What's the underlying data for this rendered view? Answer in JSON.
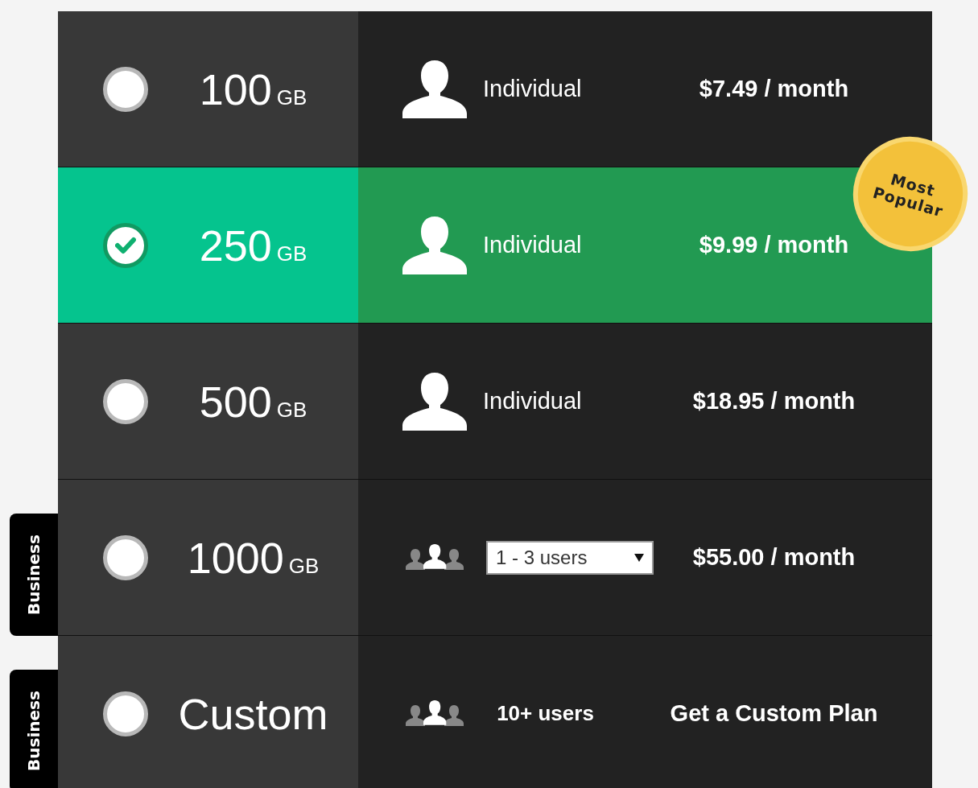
{
  "plans": [
    {
      "size": "100",
      "unit": "GB",
      "selected": false,
      "audience": {
        "kind": "individual",
        "label": "Individual"
      },
      "price": "$7.49 / month"
    },
    {
      "size": "250",
      "unit": "GB",
      "selected": true,
      "badge": "Most Popular",
      "audience": {
        "kind": "individual",
        "label": "Individual"
      },
      "price": "$9.99 / month"
    },
    {
      "size": "500",
      "unit": "GB",
      "selected": false,
      "audience": {
        "kind": "individual",
        "label": "Individual"
      },
      "price": "$18.95 / month"
    },
    {
      "size": "1000",
      "unit": "GB",
      "selected": false,
      "tag": "Business",
      "audience": {
        "kind": "group-select",
        "value": "1 - 3 users"
      },
      "price": "$55.00 / month"
    },
    {
      "size": "Custom",
      "selected": false,
      "tag": "Business",
      "audience": {
        "kind": "group",
        "label": "10+ users"
      },
      "price": "Get a Custom Plan"
    }
  ]
}
